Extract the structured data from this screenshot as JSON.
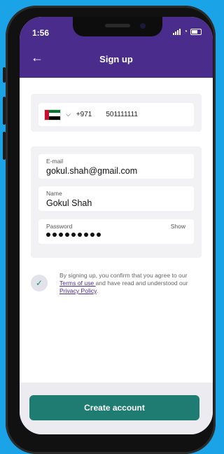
{
  "status_bar": {
    "time": "1:56"
  },
  "header": {
    "title": "Sign up",
    "back_icon": "arrow-left-icon"
  },
  "phone": {
    "country_flag": "UAE",
    "dial_code": "+971",
    "number": "501111111"
  },
  "form": {
    "email_label": "E-mail",
    "email_value": "gokul.shah@gmail.com",
    "name_label": "Name",
    "name_value": "Gokul Shah",
    "password_label": "Password",
    "password_show": "Show",
    "password_masked_length": 9
  },
  "consent": {
    "text_before": "By signing up, you confirm that you agree to our ",
    "terms_link": "Terms of use ",
    "text_middle": "and have read and understood our ",
    "privacy_link": "Privacy Policy",
    "text_after": "."
  },
  "footer": {
    "cta_label": "Create account"
  },
  "colors": {
    "brand_purple": "#4a2c8c",
    "cta_teal": "#1e7c73",
    "background_blue": "#1aa3e6"
  }
}
